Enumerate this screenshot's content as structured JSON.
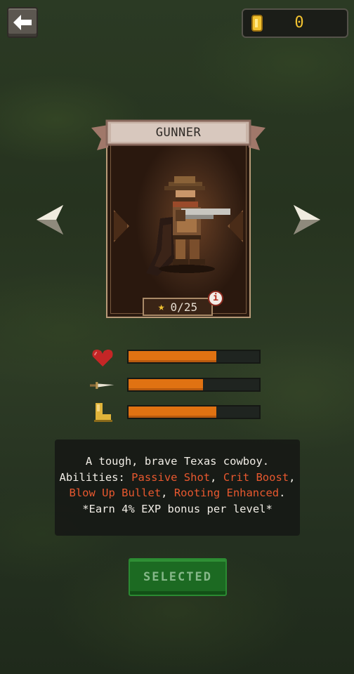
{
  "header": {
    "back_icon": "back-arrow-icon",
    "coin_icon": "gold-coin-icon",
    "coin_count": "0"
  },
  "character": {
    "name": "GUNNER",
    "stars": "0/25",
    "star_icon": "star-icon",
    "info_icon": "i",
    "portrait": "gunner-cowboy-pixel-sprite"
  },
  "navigation": {
    "prev_icon": "left-arrow-icon",
    "next_icon": "right-arrow-icon"
  },
  "stats": [
    {
      "name": "health",
      "icon": "heart-icon",
      "value": 0.67,
      "color": "#e07212"
    },
    {
      "name": "attack",
      "icon": "dagger-icon",
      "value": 0.57,
      "color": "#e07212"
    },
    {
      "name": "speed",
      "icon": "boot-icon",
      "value": 0.67,
      "color": "#e07212"
    }
  ],
  "description": {
    "line1": "A tough, brave Texas cowboy.",
    "abilities_label": "Abilities: ",
    "ability1": "Passive Shot",
    "sep1": ", ",
    "ability2": "Crit Boost",
    "sep2": ",",
    "ability3": "Blow Up Bullet",
    "sep3": ", ",
    "ability4": "Rooting Enhanced",
    "end": ".",
    "bonus": "*Earn 4% EXP bonus per level*"
  },
  "select_button": {
    "label": "SELECTED",
    "state": "selected"
  },
  "colors": {
    "accent_orange": "#e07212",
    "ability_highlight": "#e8582f",
    "button_green": "#1c6a22",
    "coin_gold": "#f2c230"
  }
}
